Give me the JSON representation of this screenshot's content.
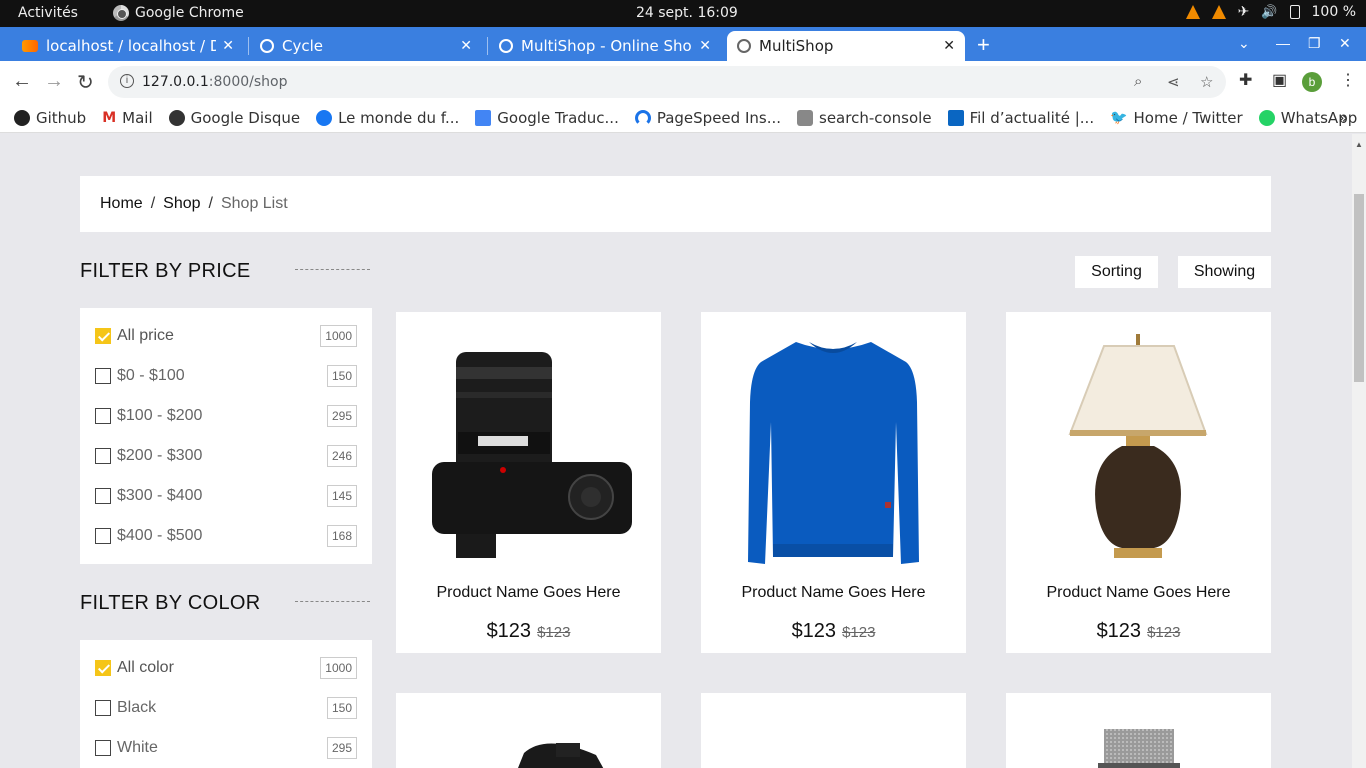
{
  "system_bar": {
    "activities": "Activités",
    "app_name": "Google Chrome",
    "datetime": "24 sept.  16:09",
    "battery": "100 %"
  },
  "browser": {
    "tabs": [
      {
        "title": "localhost / localhost / Das"
      },
      {
        "title": "Cycle"
      },
      {
        "title": "MultiShop - Online Shop W"
      },
      {
        "title": "MultiShop",
        "active": true
      }
    ],
    "address_bar": {
      "host": "127.0.0.1",
      "path": ":8000/shop"
    },
    "profile_initial": "b",
    "bookmarks": [
      {
        "label": "Github",
        "icon": "github-icon",
        "color": "#222222"
      },
      {
        "label": "Mail",
        "icon": "gmail-icon",
        "color": "#d93025"
      },
      {
        "label": "Google Disque",
        "icon": "globe-icon",
        "color": "#333333"
      },
      {
        "label": "Le monde du f...",
        "icon": "facebook-icon",
        "color": "#1877f2"
      },
      {
        "label": "Google Traduc...",
        "icon": "translate-icon",
        "color": "#4285f4"
      },
      {
        "label": "PageSpeed Ins...",
        "icon": "pagespeed-icon",
        "color": "#1a73e8"
      },
      {
        "label": "search-console",
        "icon": "search-console-icon",
        "color": "#888888"
      },
      {
        "label": "Fil d’actualité |...",
        "icon": "linkedin-icon",
        "color": "#0a66c2"
      },
      {
        "label": "Home / Twitter",
        "icon": "twitter-icon",
        "color": "#1da1f2"
      },
      {
        "label": "WhatsApp",
        "icon": "whatsapp-icon",
        "color": "#25d366"
      }
    ]
  },
  "breadcrumb": {
    "home": "Home",
    "shop": "Shop",
    "current": "Shop List"
  },
  "price_filter": {
    "title": "FILTER BY PRICE",
    "options": [
      {
        "label": "All price",
        "count": "1000",
        "checked": true
      },
      {
        "label": "$0 - $100",
        "count": "150",
        "checked": false
      },
      {
        "label": "$100 - $200",
        "count": "295",
        "checked": false
      },
      {
        "label": "$200 - $300",
        "count": "246",
        "checked": false
      },
      {
        "label": "$300 - $400",
        "count": "145",
        "checked": false
      },
      {
        "label": "$400 - $500",
        "count": "168",
        "checked": false
      }
    ]
  },
  "color_filter": {
    "title": "FILTER BY COLOR",
    "options": [
      {
        "label": "All color",
        "count": "1000",
        "checked": true
      },
      {
        "label": "Black",
        "count": "150",
        "checked": false
      },
      {
        "label": "White",
        "count": "295",
        "checked": false
      }
    ]
  },
  "toolbar": {
    "sorting_label": "Sorting",
    "showing_label": "Showing"
  },
  "products": [
    {
      "name": "Product Name Goes Here",
      "price": "$123",
      "old_price": "$123",
      "image": "camera"
    },
    {
      "name": "Product Name Goes Here",
      "price": "$123",
      "old_price": "$123",
      "image": "sweater"
    },
    {
      "name": "Product Name Goes Here",
      "price": "$123",
      "old_price": "$123",
      "image": "lamp"
    }
  ],
  "colors": {
    "accent": "#f5c518",
    "tab_strip": "#3a7fe0",
    "page_bg": "#e8e8ec",
    "sweater": "#0a5bbf"
  }
}
